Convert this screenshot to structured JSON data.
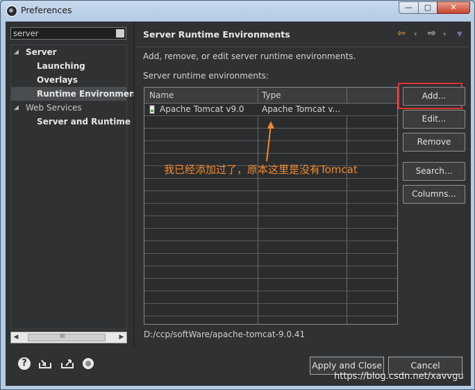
{
  "window": {
    "title": "Preferences",
    "controls": {
      "minimize": "—",
      "maximize": "▢",
      "close": "✕"
    }
  },
  "sidebar": {
    "filter_value": "server",
    "tree": [
      {
        "label": "Server",
        "twisty": "◢"
      },
      {
        "label": "Launching"
      },
      {
        "label": "Overlays"
      },
      {
        "label": "Runtime Environmen"
      },
      {
        "label": "Web Services",
        "twisty": "◢"
      },
      {
        "label": "Server and Runtime"
      }
    ],
    "scroll_left": "◀",
    "scroll_right": "▶",
    "scroll_grip": "III"
  },
  "page": {
    "title": "Server Runtime Environments",
    "description": "Add, remove, or edit server runtime environments.",
    "list_label": "Server runtime environments:",
    "nav": {
      "back": "⇦",
      "forward": "⇨",
      "dropdown": "▾",
      "menu": "▼"
    }
  },
  "table": {
    "columns": [
      "Name",
      "Type"
    ],
    "rows": [
      {
        "name": "Apache Tomcat v9.0",
        "type": "Apache Tomcat v..."
      }
    ]
  },
  "buttons": {
    "add": "Add...",
    "edit": "Edit...",
    "remove": "Remove",
    "search": "Search...",
    "columns": "Columns..."
  },
  "location_path": "D:/ccp/softWare/apache-tomcat-9.0.41",
  "annotation": {
    "text": "我已经添加过了，原本这里是没有Tomcat",
    "color": "#f08a2c"
  },
  "footer": {
    "help_icon": "?",
    "apply_close": "Apply and Close",
    "cancel": "Cancel"
  },
  "watermark": "https://blog.csdn.net/xavvgu",
  "colors": {
    "accent_red": "#e0342b",
    "background": "#2f3133"
  }
}
